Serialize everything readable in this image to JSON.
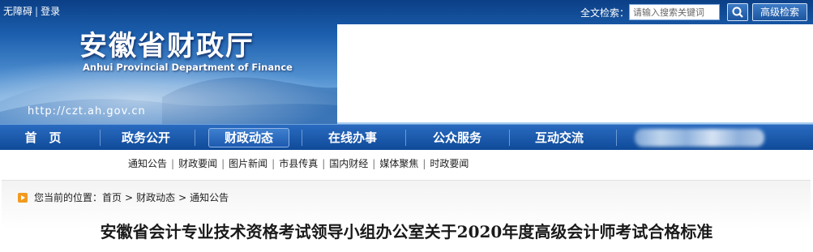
{
  "header": {
    "accessibility_label": "无障碍",
    "login_label": "登录",
    "separator": "|",
    "site_title": "安徽省财政厅",
    "site_subtitle": "Anhui Provincial Department of Finance",
    "site_url": "http://czt.ah.gov.cn"
  },
  "search": {
    "label": "全文检索：",
    "placeholder": "请输入搜索关键词",
    "submit_icon": "search-icon",
    "advanced_label": "高级检索"
  },
  "nav": {
    "items": [
      {
        "label": "首　页"
      },
      {
        "label": "政务公开"
      },
      {
        "label": "财政动态"
      },
      {
        "label": "在线办事"
      },
      {
        "label": "公众服务"
      },
      {
        "label": "互动交流"
      }
    ],
    "active_index": 2
  },
  "subnav": {
    "items": [
      "通知公告",
      "财政要闻",
      "图片新闻",
      "市县传真",
      "国内财经",
      "媒体聚焦",
      "时政要闻"
    ]
  },
  "breadcrumb": {
    "prefix": "您当前的位置：",
    "items": [
      "首页",
      "财政动态",
      "通知公告"
    ],
    "arrow": ">"
  },
  "article": {
    "title": "安徽省会计专业技术资格考试领导小组办公室关于2020年度高级会计师考试合格标准"
  },
  "colors": {
    "nav_bg": "#1a5bb0",
    "banner_top": "#0b3f86",
    "accent_orange": "#f29a1f"
  }
}
